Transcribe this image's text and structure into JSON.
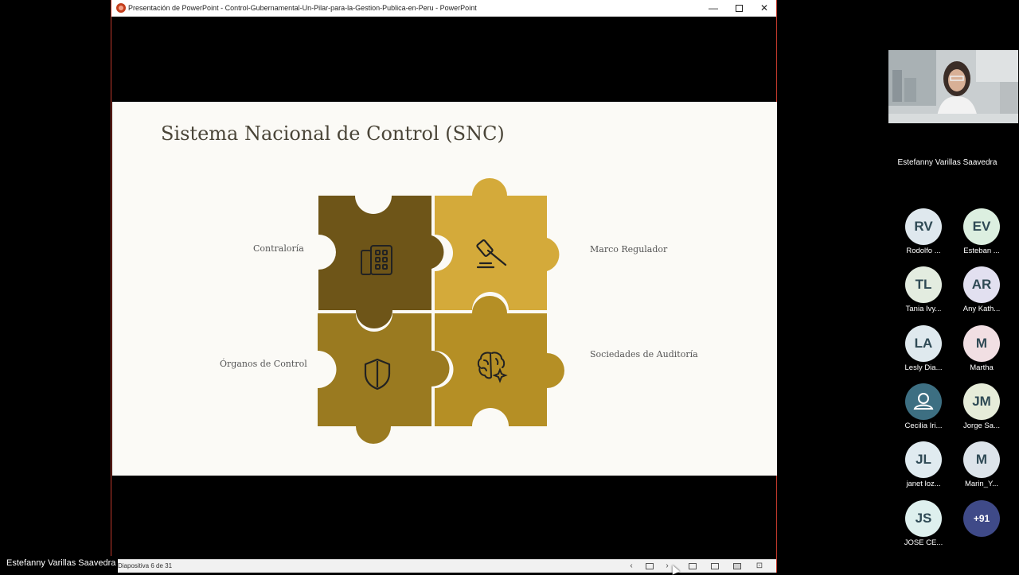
{
  "window": {
    "title": "Presentación de PowerPoint  -  Control-Gubernamental-Un-Pilar-para-la-Gestion-Publica-en-Peru  -  PowerPoint",
    "minimize": "—",
    "close": "✕"
  },
  "slide": {
    "title": "Sistema Nacional de Control (SNC)",
    "labels": {
      "contraloria": "Contraloría",
      "marco": "Marco Regulador",
      "organos": "Órganos de Control",
      "sociedades": "Sociedades de Auditoría"
    },
    "piece_colors": {
      "top_left": "#6e5518",
      "top_right": "#d4aa3a",
      "bottom_left": "#9a7a20",
      "bottom_right": "#b58f25"
    },
    "icons": {
      "contraloria": "building-icon",
      "marco": "gavel-icon",
      "organos": "shield-icon",
      "sociedades": "brain-icon"
    }
  },
  "statusbar": {
    "slide_counter": "Diapositiva 6 de 31"
  },
  "presenter": {
    "name": "Estefanny Varillas Saavedra"
  },
  "participants": [
    {
      "initials": "RV",
      "name": "Rodolfo ...",
      "color": "#dfe8ee"
    },
    {
      "initials": "EV",
      "name": "Esteban ...",
      "color": "#dcefe0"
    },
    {
      "initials": "TL",
      "name": "Tania Ivy...",
      "color": "#e3ece0"
    },
    {
      "initials": "AR",
      "name": "Any Kath...",
      "color": "#e2e0f0"
    },
    {
      "initials": "LA",
      "name": "Lesly Dia...",
      "color": "#dfe9ee"
    },
    {
      "initials": "M",
      "name": "Martha",
      "color": "#f1dfe3"
    },
    {
      "initials": "",
      "name": "Cecilia Iri...",
      "color": "#3d6f82"
    },
    {
      "initials": "JM",
      "name": "Jorge Sa...",
      "color": "#e6ecd9"
    },
    {
      "initials": "JL",
      "name": "janet loz...",
      "color": "#e0ebf0"
    },
    {
      "initials": "M",
      "name": "Marin_Y...",
      "color": "#dde4ea"
    },
    {
      "initials": "JS",
      "name": "JOSE CE...",
      "color": "#def0ee"
    },
    {
      "initials": "+91",
      "name": "",
      "color": "#3f4a88"
    }
  ]
}
